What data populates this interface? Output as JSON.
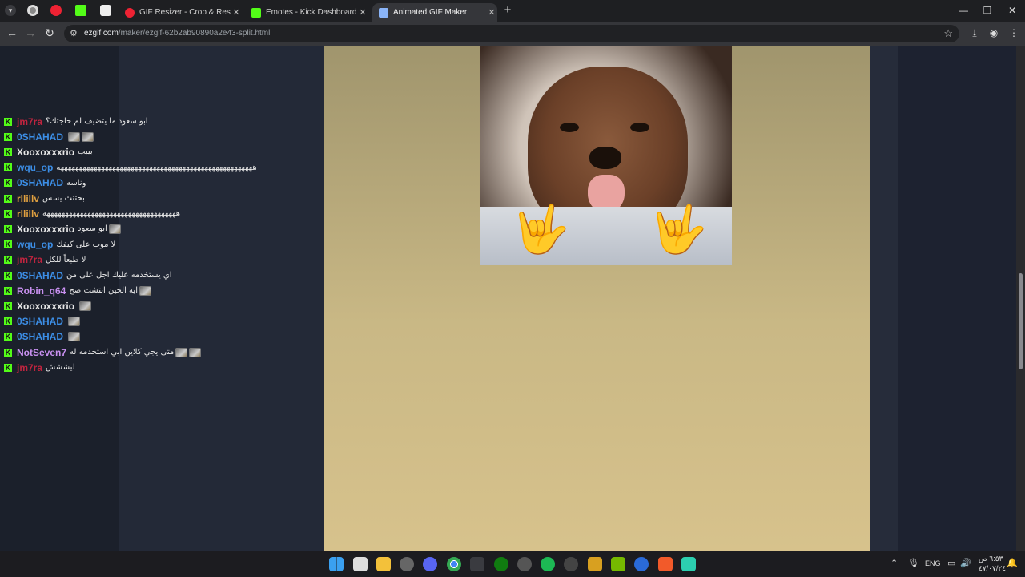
{
  "tabs": [
    {
      "title": "GIF Resizer - Crop & Resize Ani",
      "active": false
    },
    {
      "title": "Emotes - Kick Dashboard",
      "active": false
    },
    {
      "title": "Animated GIF Maker",
      "active": true
    }
  ],
  "close_glyph": "✕",
  "new_tab_glyph": "+",
  "window_controls": {
    "minimize": "—",
    "maximize": "❐",
    "close": "✕"
  },
  "url": {
    "domain": "ezgif.com",
    "path": "/maker/ezgif-62b2ab90890a2e43-split.html"
  },
  "kick_badge": "K",
  "chat": [
    {
      "user": "jm7ra",
      "color": "#c0243f",
      "message": "ابو سعود ما يتضيف لم حاجتك؟",
      "emotes": 0
    },
    {
      "user": "0SHAHAD",
      "color": "#3c8ee6",
      "message": "",
      "emotes": 2
    },
    {
      "user": "Xooxoxxxrio",
      "color": "#e6e6e6",
      "message": "بيبب",
      "emotes": 0
    },
    {
      "user": "wqu_op",
      "color": "#3c8ee6",
      "message": "هههههههههههههههههههههههههههههههههههههههههههههههههههههه",
      "emotes": 0
    },
    {
      "user": "0SHAHAD",
      "color": "#3c8ee6",
      "message": "وناسه",
      "emotes": 0
    },
    {
      "user": "rllillv",
      "color": "#e0a040",
      "message": "بحثثث يسس",
      "emotes": 0
    },
    {
      "user": "rllillv",
      "color": "#e0a040",
      "message": "ههههههههههههههههههههههههههههههههههههه",
      "emotes": 0
    },
    {
      "user": "Xooxoxxxrio",
      "color": "#e6e6e6",
      "message": "ابو سعود",
      "emotes": 1
    },
    {
      "user": "wqu_op",
      "color": "#3c8ee6",
      "message": "لا موب على كيفك",
      "emotes": 0
    },
    {
      "user": "jm7ra",
      "color": "#c0243f",
      "message": "لا طبعاً للكل",
      "emotes": 0
    },
    {
      "user": "0SHAHAD",
      "color": "#3c8ee6",
      "message": "اي يستخدمه عليك اجل على من",
      "emotes": 0
    },
    {
      "user": "Robin_q64",
      "color": "#c890f0",
      "message": "ايه الحين انتشت صح",
      "emotes": 1
    },
    {
      "user": "Xooxoxxxrio",
      "color": "#e6e6e6",
      "message": "",
      "emotes": 1
    },
    {
      "user": "0SHAHAD",
      "color": "#3c8ee6",
      "message": "",
      "emotes": 1
    },
    {
      "user": "0SHAHAD",
      "color": "#3c8ee6",
      "message": "",
      "emotes": 1
    },
    {
      "user": "NotSeven7",
      "color": "#c890f0",
      "message": "متى يجي كلاين ابي استخدمه له",
      "emotes": 2
    },
    {
      "user": "jm7ra",
      "color": "#c0243f",
      "message": "ليششش",
      "emotes": 0
    }
  ],
  "gif_emoji": "🤟",
  "tray": {
    "language": "ENG",
    "time": "٦:٥٣ ص",
    "date": "٤٧/٠٧/٢٤"
  },
  "colors": {
    "kick_green": "#53fc18",
    "gold_bg": "#c9b885",
    "chrome_dark": "#35363a"
  }
}
